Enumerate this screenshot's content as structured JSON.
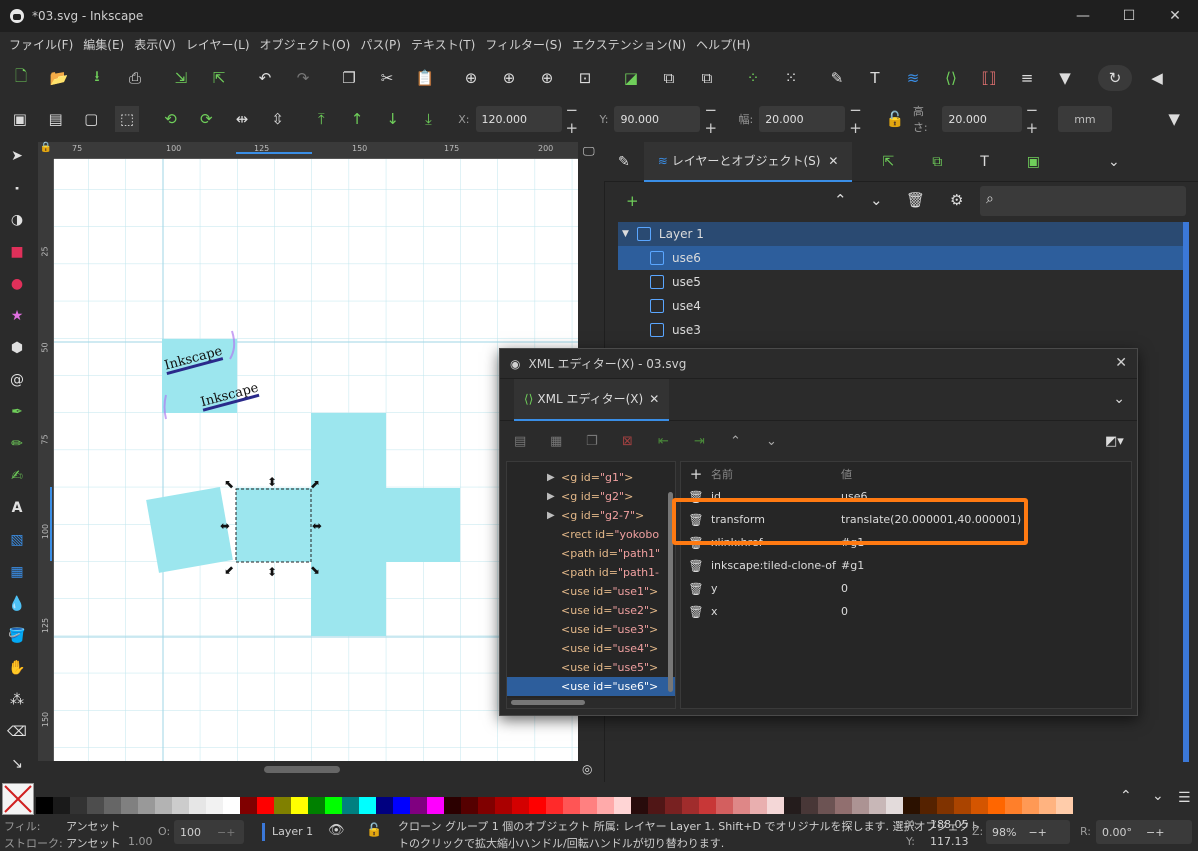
{
  "window": {
    "title": "*03.svg - Inkscape"
  },
  "menu": [
    "ファイル(F)",
    "編集(E)",
    "表示(V)",
    "レイヤー(L)",
    "オブジェクト(O)",
    "パス(P)",
    "テキスト(T)",
    "フィルター(S)",
    "エクステンション(N)",
    "ヘルプ(H)"
  ],
  "controls": {
    "x_label": "X:",
    "x_value": "120.000",
    "y_label": "Y:",
    "y_value": "90.000",
    "w_label": "幅:",
    "w_value": "20.000",
    "h_label": "高さ:",
    "h_value": "20.000",
    "unit": "mm"
  },
  "ruler": {
    "h_ticks": [
      "75",
      "100",
      "125",
      "150",
      "175",
      "200"
    ],
    "v_ticks": [
      "25",
      "50",
      "75",
      "100",
      "125",
      "150"
    ]
  },
  "canvas": {
    "text1": "Inkscape",
    "text2": "Inkscape"
  },
  "dock": {
    "active_tab": "レイヤーとオブジェクト(S)",
    "layer_name": "Layer 1",
    "objects": [
      "use6",
      "use5",
      "use4",
      "use3"
    ]
  },
  "xml": {
    "dialog_title": "XML エディター(X) - 03.svg",
    "tab_label": "XML エディター(X)",
    "col_name": "名前",
    "col_value": "値",
    "nodes": [
      {
        "tag": "<g id=",
        "id": "\"g1\"",
        "end": ">",
        "expandable": true
      },
      {
        "tag": "<g id=",
        "id": "\"g2\"",
        "end": ">",
        "expandable": true
      },
      {
        "tag": "<g id=",
        "id": "\"g2-7\"",
        "end": ">",
        "expandable": true
      },
      {
        "tag": "<rect id=",
        "id": "\"yokobo",
        "end": "",
        "expandable": false
      },
      {
        "tag": "<path id=",
        "id": "\"path1\"",
        "end": "",
        "expandable": false
      },
      {
        "tag": "<path id=",
        "id": "\"path1-",
        "end": "",
        "expandable": false
      },
      {
        "tag": "<use id=",
        "id": "\"use1\"",
        "end": ">",
        "expandable": false
      },
      {
        "tag": "<use id=",
        "id": "\"use2\"",
        "end": ">",
        "expandable": false
      },
      {
        "tag": "<use id=",
        "id": "\"use3\"",
        "end": ">",
        "expandable": false
      },
      {
        "tag": "<use id=",
        "id": "\"use4\"",
        "end": ">",
        "expandable": false
      },
      {
        "tag": "<use id=",
        "id": "\"use5\"",
        "end": ">",
        "expandable": false
      },
      {
        "tag": "<use id=",
        "id": "\"use6\"",
        "end": ">",
        "expandable": false
      }
    ],
    "attributes": [
      {
        "name": "id",
        "value": "use6"
      },
      {
        "name": "transform",
        "value": "translate(20.000001,40.000001)"
      },
      {
        "name": "xlink:href",
        "value": "#g1"
      },
      {
        "name": "inkscape:tiled-clone-of",
        "value": "#g1"
      },
      {
        "name": "y",
        "value": "0"
      },
      {
        "name": "x",
        "value": "0"
      }
    ]
  },
  "status": {
    "fill_label": "フィル:",
    "fill_value": "アンセット",
    "stroke_label": "ストローク:",
    "stroke_value": "アンセット",
    "stroke_width": "1.00",
    "opacity_label": "O:",
    "opacity": "100",
    "layer": "Layer 1",
    "message_line1": "クローン グループ 1 個のオブジェクト 所属: レイヤー Layer 1. Shift+D でオリジナルを探します. 選択オブジェクト",
    "message_line2": "トのクリックで拡大縮小ハンドル/回転ハンドルが切り替わります.",
    "cursor_x_label": "X:",
    "cursor_x": "188.05",
    "cursor_y_label": "Y:",
    "cursor_y": "117.13",
    "zoom_label": "Z:",
    "zoom": "98%",
    "rotation_label": "R:",
    "rotation": "0.00°"
  },
  "palette": [
    "#000000",
    "#1a1a1a",
    "#333333",
    "#4d4d4d",
    "#666666",
    "#808080",
    "#999999",
    "#b3b3b3",
    "#cccccc",
    "#e6e6e6",
    "#f2f2f2",
    "#ffffff",
    "#800000",
    "#ff0000",
    "#808000",
    "#ffff00",
    "#008000",
    "#00ff00",
    "#008080",
    "#00ffff",
    "#000080",
    "#0000ff",
    "#800080",
    "#ff00ff",
    "#2b0000",
    "#550000",
    "#800000",
    "#aa0000",
    "#d40000",
    "#ff0000",
    "#ff2a2a",
    "#ff5555",
    "#ff8080",
    "#ffaaaa",
    "#ffd5d5",
    "#280b0b",
    "#501616",
    "#782121",
    "#a02c2c",
    "#c83737",
    "#d35f5f",
    "#de8787",
    "#e9afaf",
    "#f4d7d7",
    "#241c1c",
    "#483737",
    "#6c5353",
    "#916f6f",
    "#ac9393",
    "#c8b7b7",
    "#e3dbdb",
    "#2b1100",
    "#552200",
    "#803300",
    "#aa4400",
    "#d45500",
    "#ff6600",
    "#ff7f2a",
    "#ff9955",
    "#ffb380",
    "#ffccaa"
  ]
}
